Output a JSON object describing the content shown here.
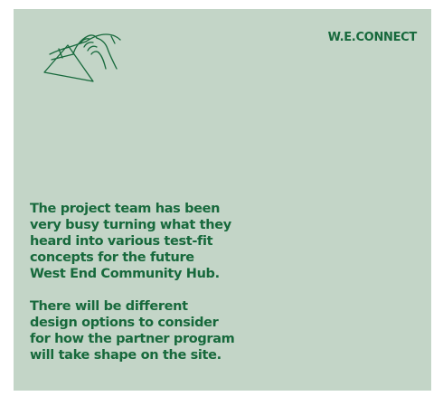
{
  "brand": {
    "name": "W.E.CONNECT",
    "logo_icon": "handshake-outline-icon"
  },
  "colors": {
    "background": "#c3d5c7",
    "text": "#17693c"
  },
  "paragraphs": [
    "The project team has been\nvery busy turning what they\nheard into various test-fit\nconcepts for the future\nWest End Community Hub.",
    "There will be different\ndesign options to consider\nfor how the partner program\nwill take shape on the site."
  ]
}
